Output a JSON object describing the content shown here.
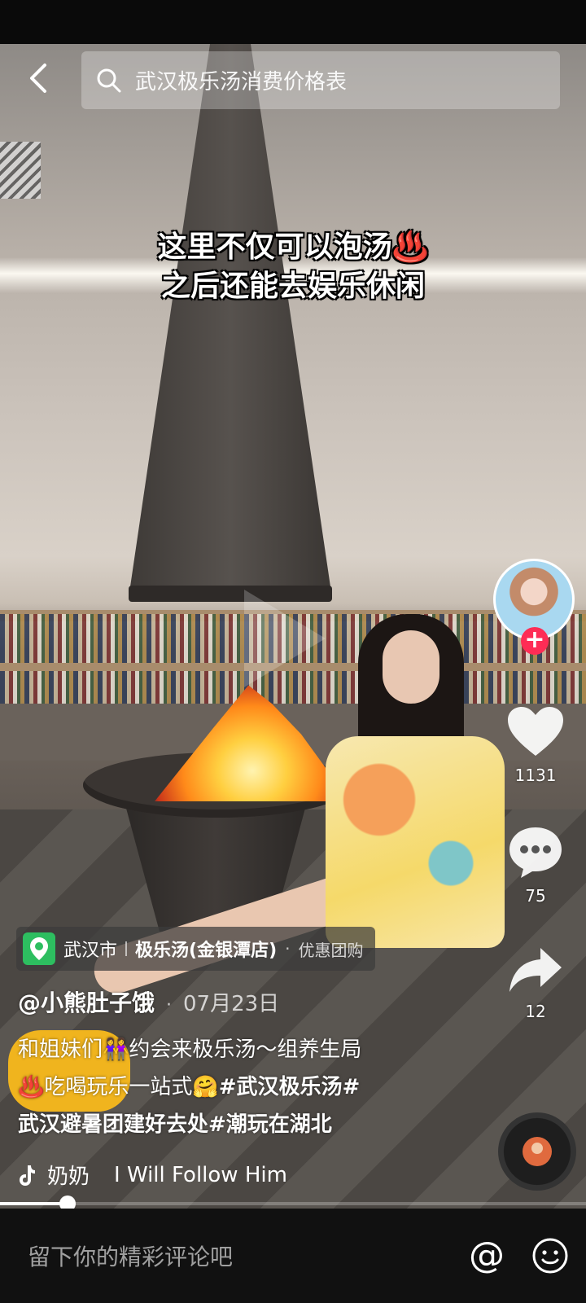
{
  "search": {
    "query": "武汉极乐汤消费价格表"
  },
  "caption": {
    "line1": "这里不仅可以泡汤♨️",
    "line2": "之后还能去娱乐休闲"
  },
  "actions": {
    "likes": "1131",
    "comments": "75",
    "shares": "12"
  },
  "poi": {
    "city": "武汉市",
    "store": "极乐汤(金银潭店)",
    "deal": "优惠团购"
  },
  "post": {
    "author": "@小熊肚子饿",
    "date": "07月23日",
    "line1": "和姐妹们👭约会来极乐汤～组养生局",
    "line2_prefix": "♨️吃喝玩乐一站式🤗",
    "tag1": "#武汉极乐汤#",
    "tag2": "武汉避暑团建好去处#潮玩在湖北"
  },
  "music": {
    "artist": "奶奶",
    "title": "I Will Follow Him"
  },
  "progress": {
    "fraction": 0.115
  },
  "comment": {
    "placeholder": "留下你的精彩评论吧"
  },
  "colors": {
    "follow": "#fe2c55",
    "poi_icon": "#2dbe60"
  },
  "icons": [
    "back-icon",
    "search-icon",
    "follow-plus-icon",
    "heart-icon",
    "comment-icon",
    "share-icon",
    "location-pin-icon",
    "tiktok-note-icon",
    "at-icon",
    "emoji-icon"
  ]
}
